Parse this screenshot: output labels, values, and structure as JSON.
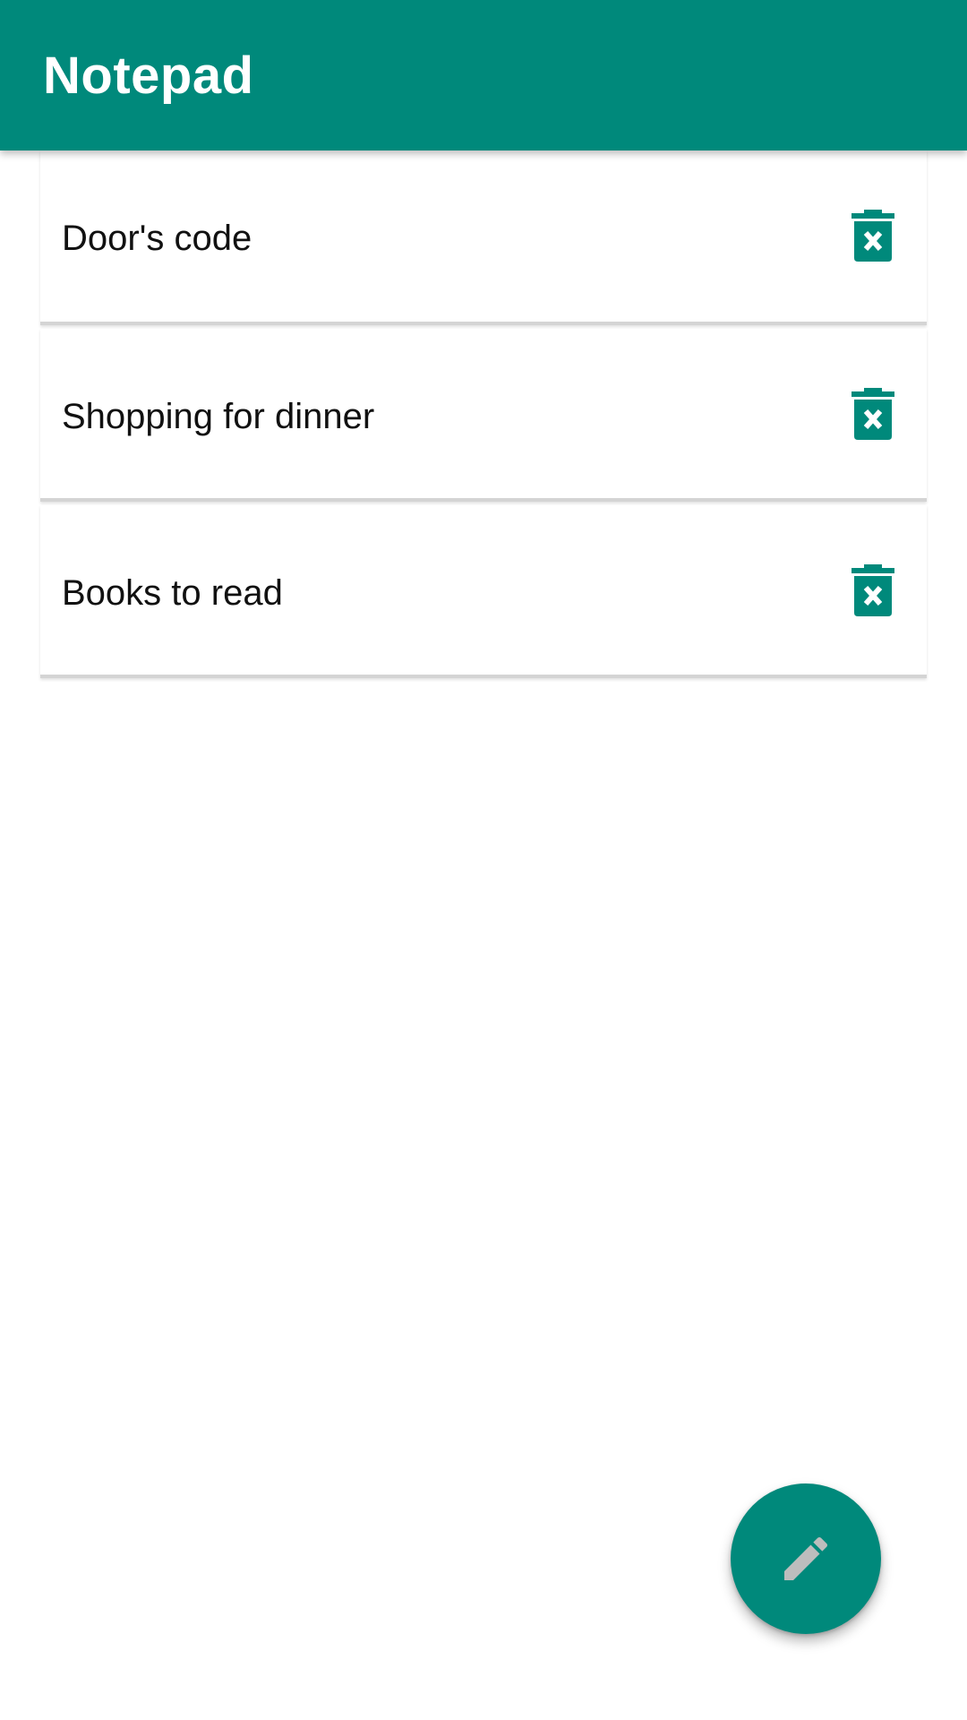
{
  "app_bar": {
    "title": "Notepad",
    "color": "#00897b"
  },
  "notes": [
    {
      "title": "Door's code",
      "delete_icon": "delete-forever-icon"
    },
    {
      "title": "Shopping for dinner",
      "delete_icon": "delete-forever-icon"
    },
    {
      "title": "Books to read",
      "delete_icon": "delete-forever-icon"
    }
  ],
  "fab": {
    "icon": "pencil-icon",
    "color": "#00897b",
    "icon_color": "#bdbdbd"
  }
}
